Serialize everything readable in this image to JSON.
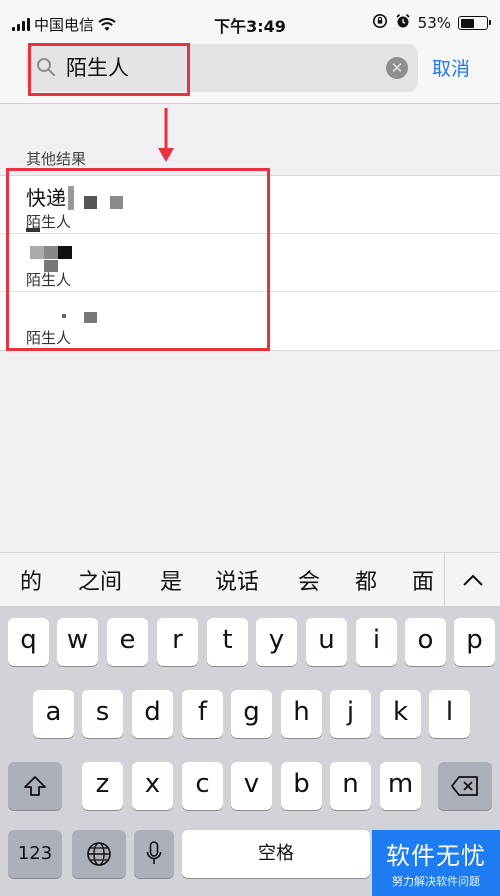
{
  "status_bar": {
    "carrier": "中国电信",
    "time": "下午3:49",
    "battery_percent": "53%",
    "battery_level": 0.53
  },
  "search": {
    "query": "陌生人",
    "cancel_label": "取消"
  },
  "results": {
    "section_label": "其他结果",
    "items": [
      {
        "title": "快递",
        "subtitle": "陌生人"
      },
      {
        "title": "",
        "subtitle": "陌生人"
      },
      {
        "title": "",
        "subtitle": "陌生人"
      }
    ]
  },
  "suggestions": [
    "的",
    "之间",
    "是",
    "说话",
    "会",
    "都",
    "面"
  ],
  "keyboard": {
    "row1": [
      "q",
      "w",
      "e",
      "r",
      "t",
      "y",
      "u",
      "i",
      "o",
      "p"
    ],
    "row2": [
      "a",
      "s",
      "d",
      "f",
      "g",
      "h",
      "j",
      "k",
      "l"
    ],
    "row3": [
      "z",
      "x",
      "c",
      "v",
      "b",
      "n",
      "m"
    ],
    "numbers_label": "123",
    "space_label": "空格"
  },
  "watermark": {
    "title": "软件无忧",
    "subtitle": "努力解决软件问题"
  },
  "colors": {
    "annotation_red": "#e8323d",
    "ios_blue": "#1d7cf2"
  },
  "icons": [
    "signal-icon",
    "wifi-icon",
    "orientation-lock-icon",
    "alarm-icon",
    "battery-icon",
    "search-icon",
    "clear-icon",
    "arrow-down-annotation",
    "chevron-up-icon",
    "shift-icon",
    "backspace-icon",
    "globe-icon",
    "microphone-icon"
  ]
}
